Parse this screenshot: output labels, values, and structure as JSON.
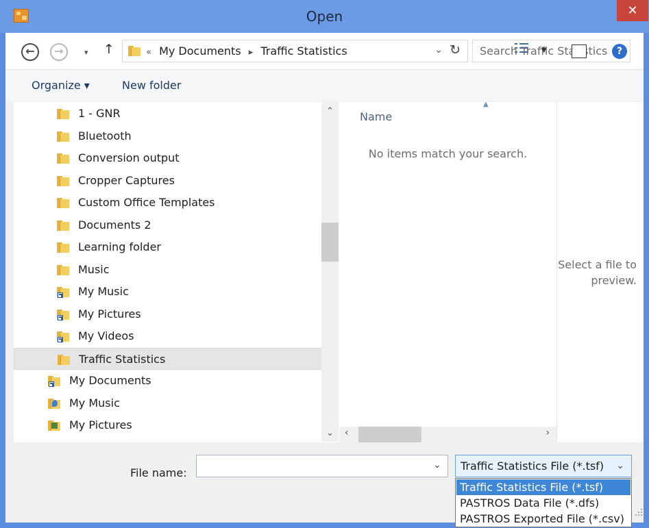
{
  "window": {
    "title": "Open",
    "close_glyph": "✕"
  },
  "navigation": {
    "back_glyph": "←",
    "forward_glyph": "→",
    "recent_glyph": "▾",
    "up_glyph": "↑",
    "breadcrumb_prefix": "«",
    "breadcrumb": [
      "My Documents",
      "Traffic Statistics"
    ],
    "breadcrumb_sep": "▸",
    "dropdown_glyph": "⌄",
    "refresh_glyph": "↻",
    "search_placeholder": "Search Traffic Statistics",
    "search_glyph": "⚲"
  },
  "toolbar": {
    "organize_label": "Organize ▾",
    "new_folder_label": "New folder",
    "view_dropdown_glyph": "▼",
    "help_glyph": "?"
  },
  "tree": {
    "items": [
      {
        "label": "1 - GNR",
        "icon": "folder-icon",
        "level": 2
      },
      {
        "label": "Bluetooth",
        "icon": "folder-icon",
        "level": 2
      },
      {
        "label": "Conversion output",
        "icon": "folder-icon",
        "level": 2
      },
      {
        "label": "Cropper Captures",
        "icon": "folder-icon",
        "level": 2
      },
      {
        "label": "Custom Office Templates",
        "icon": "folder-icon",
        "level": 2
      },
      {
        "label": "Documents 2",
        "icon": "folder-icon",
        "level": 2
      },
      {
        "label": "Learning folder",
        "icon": "folder-icon",
        "level": 2
      },
      {
        "label": "Music",
        "icon": "folder-icon",
        "level": 2
      },
      {
        "label": "My Music",
        "icon": "shortcut-folder-icon",
        "level": 2
      },
      {
        "label": "My Pictures",
        "icon": "shortcut-folder-icon",
        "level": 2
      },
      {
        "label": "My Videos",
        "icon": "shortcut-folder-icon",
        "level": 2
      },
      {
        "label": "Traffic Statistics",
        "icon": "folder-icon",
        "level": 2,
        "selected": true
      },
      {
        "label": "My Documents",
        "icon": "shortcut-folder-icon",
        "level": 1
      },
      {
        "label": "My Music",
        "icon": "music-library-icon",
        "level": 1
      },
      {
        "label": "My Pictures",
        "icon": "pictures-library-icon",
        "level": 1
      }
    ]
  },
  "file_list": {
    "column_name": "Name",
    "sort_glyph": "▲",
    "empty_message": "No items match your search."
  },
  "scrollbars": {
    "up": "⌃",
    "down": "⌄",
    "left": "‹",
    "right": "›"
  },
  "preview": {
    "message_line1": "Select a file to",
    "message_line2": "preview."
  },
  "bottom": {
    "file_name_label": "File name:",
    "file_name_value": "",
    "file_name_dropdown_glyph": "⌄",
    "file_type_selected": "Traffic Statistics File (*.tsf)",
    "file_type_dropdown_glyph": "⌄",
    "file_type_options": [
      "Traffic Statistics File (*.tsf)",
      "PASTROS Data File (*.dfs)",
      "PASTROS Exported File (*.csv)"
    ]
  },
  "colors": {
    "title_bar": "#6b9be6",
    "close_button": "#c7453a",
    "selection": "#3e86d6",
    "folder": "#f3cd5e"
  }
}
